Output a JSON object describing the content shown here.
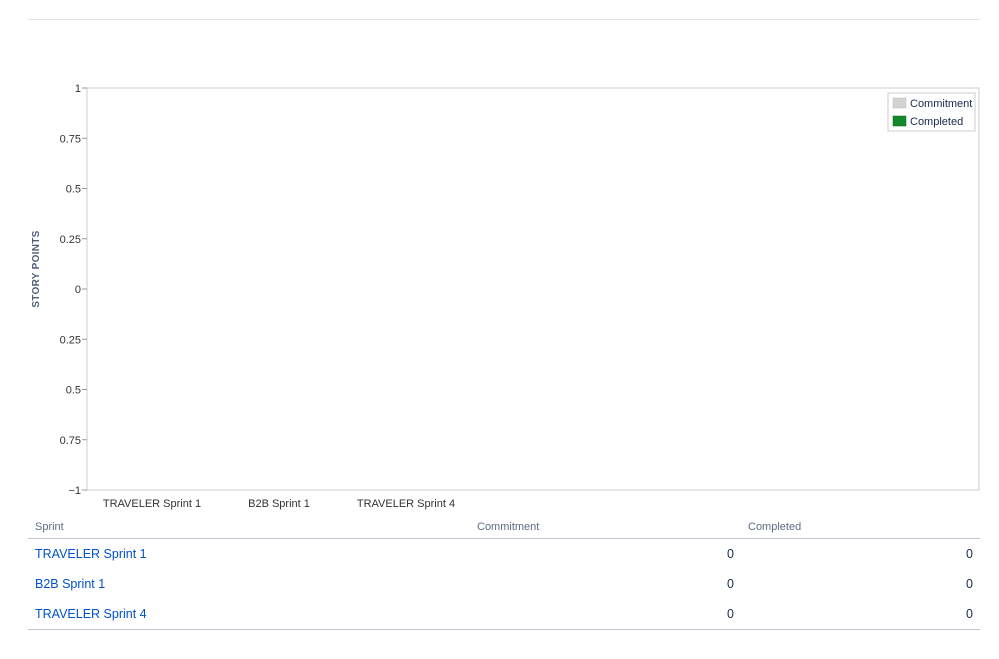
{
  "chart_data": {
    "type": "bar",
    "categories": [
      "TRAVELER Sprint 1",
      "B2B Sprint 1",
      "TRAVELER Sprint 4"
    ],
    "series": [
      {
        "name": "Commitment",
        "values": [
          0,
          0,
          0
        ],
        "color": "#d3d3d3"
      },
      {
        "name": "Completed",
        "values": [
          0,
          0,
          0
        ],
        "color": "#14892c"
      }
    ],
    "ylabel": "STORY POINTS",
    "ylim": [
      -1,
      1
    ],
    "y_ticks": [
      "1",
      "0.75",
      "0.5",
      "0.25",
      "0",
      "0.25",
      "0.5",
      "0.75",
      "−1"
    ],
    "legend_position": "top-right",
    "grid": false
  },
  "table": {
    "headers": {
      "sprint": "Sprint",
      "commitment": "Commitment",
      "completed": "Completed"
    },
    "rows": [
      {
        "sprint": "TRAVELER Sprint 1",
        "commitment": "0",
        "completed": "0"
      },
      {
        "sprint": "B2B Sprint 1",
        "commitment": "0",
        "completed": "0"
      },
      {
        "sprint": "TRAVELER Sprint 4",
        "commitment": "0",
        "completed": "0"
      }
    ]
  },
  "colors": {
    "link": "#0052cc",
    "commitment": "#d3d3d3",
    "completed": "#14892c"
  }
}
